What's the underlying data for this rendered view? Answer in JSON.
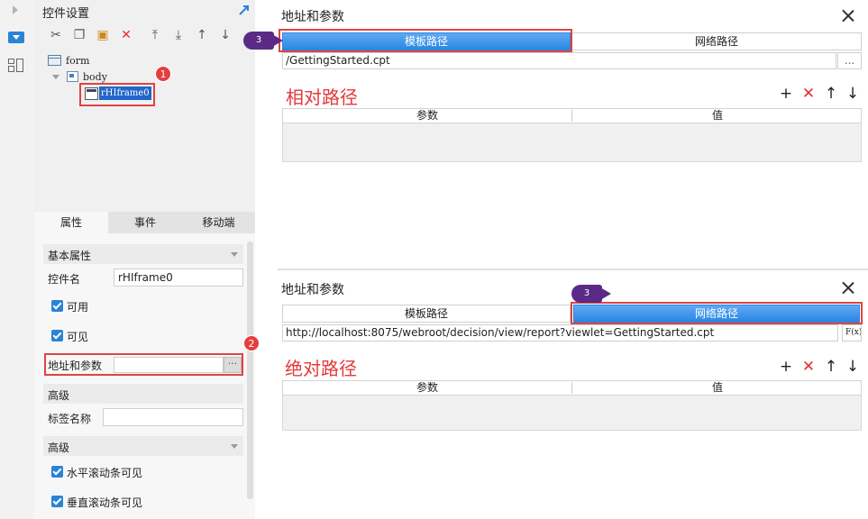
{
  "panel": {
    "title": "控件设置",
    "tree": {
      "form": "form",
      "body": "body",
      "selected": "rHIframe0"
    },
    "tabs": [
      "属性",
      "事件",
      "移动端"
    ],
    "sections": {
      "basic": "基本属性",
      "advanced1": "高级",
      "advanced2": "高级"
    },
    "fields": {
      "name_label": "控件名",
      "name_value": "rHIframe0",
      "enabled": "可用",
      "visible": "可见",
      "address_label": "地址和参数",
      "address_btn": "···",
      "tag_label": "标签名称",
      "tag_value": "",
      "hscroll": "水平滚动条可见",
      "vscroll": "垂直滚动条可见"
    },
    "badges": {
      "one": "1",
      "two": "2"
    }
  },
  "dialog_top": {
    "title": "地址和参数",
    "seg_left": "模板路径",
    "seg_right": "网络路径",
    "path": "/GettingStarted.cpt",
    "path_btn": "...",
    "caption": "相对路径",
    "col_param": "参数",
    "col_value": "值",
    "badge": "3"
  },
  "dialog_bottom": {
    "title": "地址和参数",
    "seg_left": "模板路径",
    "seg_right": "网络路径",
    "path": "http://localhost:8075/webroot/decision/view/report?viewlet=GettingStarted.cpt",
    "fx_btn": "F(x)",
    "caption": "绝对路径",
    "col_param": "参数",
    "col_value": "值",
    "badge": "3"
  },
  "colors": {
    "accent_blue": "#2b86e2",
    "highlight_red": "#e04343",
    "badge_purple": "#5b2a86",
    "caption_red": "#e5383b"
  }
}
